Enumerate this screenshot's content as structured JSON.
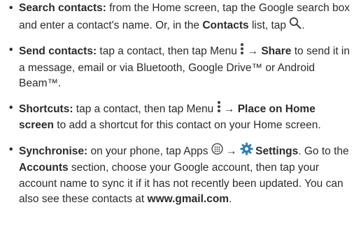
{
  "items": [
    {
      "title": "Search contacts:",
      "t1": " from the Home screen, tap the Google search box and enter a contact's name. Or, in the ",
      "b1": "Contacts",
      "t2": " list, tap ",
      "t3": ".",
      "icon": "search-icon"
    },
    {
      "title": "Send contacts:",
      "t1": " tap a contact, then tap Menu ",
      "arrow": " → ",
      "b1": "Share",
      "t2": " to send it in a message, email or via Bluetooth, Google Drive™ or Android Beam™.",
      "icon": "menu-icon"
    },
    {
      "title": "Shortcuts:",
      "t1": " tap a contact, then tap Menu ",
      "arrow": " → ",
      "b1": "Place on Home screen",
      "t2": " to add a shortcut for this contact on your Home screen.",
      "icon": "menu-icon"
    },
    {
      "title": "Synchronise:",
      "t1": " on your phone, tap Apps ",
      "arrow": " → ",
      "b1": "Settings",
      "t2": ". Go to the ",
      "b2": "Accounts",
      "t3": " section, choose your Google account, then tap your account name to sync it if it has not recently been updated. You can also see these contacts at ",
      "b3": "www.gmail.com",
      "t4": ".",
      "icons": [
        "apps-icon",
        "settings-gear-icon"
      ]
    }
  ],
  "bullet": "•",
  "colors": {
    "text": "#2b2b2b",
    "icon": "#444444",
    "gear": "#2f7fb0"
  }
}
